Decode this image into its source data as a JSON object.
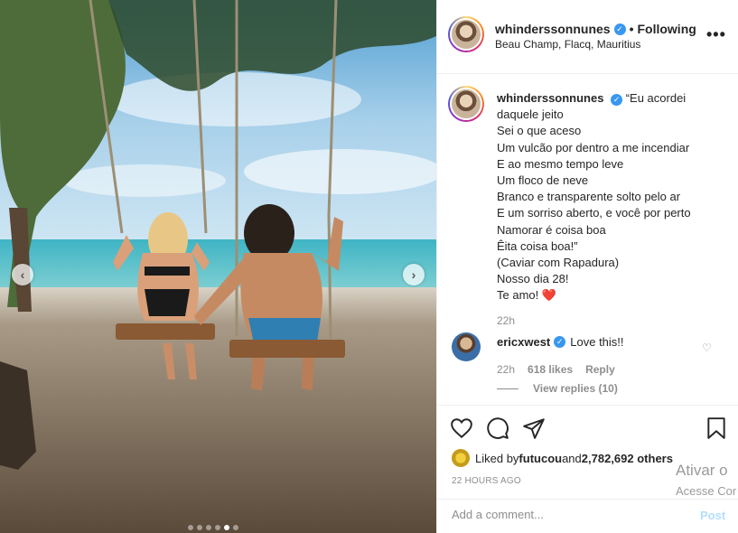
{
  "post": {
    "username": "whinderssonnunes",
    "follow_separator": "•",
    "follow_status": "Following",
    "location": "Beau Champ, Flacq, Mauritius",
    "more_icon": "more-options-icon",
    "verified_icon": "verified-badge-icon"
  },
  "caption": {
    "username": "whinderssonnunes",
    "lines": [
      "“Eu acordei",
      "daquele jeito",
      "Sei o que aceso",
      "Um vulcão por dentro a me incendiar",
      "E ao mesmo tempo leve",
      "Um floco de neve",
      "Branco e transparente solto pelo ar",
      "E um sorriso aberto, e você por perto",
      "Namorar é coisa boa",
      "Êita coisa boa!”",
      "(Caviar com Rapadura)",
      "Nosso dia 28!",
      "Te amo!"
    ],
    "heart_emoji": "❤️",
    "time": "22h"
  },
  "comment": {
    "username": "ericxwest",
    "text": "Love this!!",
    "time": "22h",
    "likes": "618 likes",
    "reply_label": "Reply",
    "view_replies": "View replies (10)"
  },
  "actions": {
    "icons": [
      "heart-icon",
      "comment-icon",
      "share-icon",
      "bookmark-icon"
    ],
    "liked_by_prefix": "Liked by ",
    "liked_by_user": "futucou",
    "liked_by_and": " and ",
    "liked_by_others": "2,782,692 others",
    "time_ago": "22 HOURS AGO"
  },
  "add_comment": {
    "placeholder": "Add a comment...",
    "post_label": "Post"
  },
  "carousel": {
    "prev_glyph": "‹",
    "next_glyph": "›",
    "slide_count": 6,
    "active_index": 4
  },
  "watermark": {
    "line1": "Ativar o",
    "line2": "Acesse Cor"
  },
  "colors": {
    "accent_blue": "#3897f0",
    "text": "#262626",
    "secondary": "#8e8e8e",
    "border": "#efefef"
  }
}
